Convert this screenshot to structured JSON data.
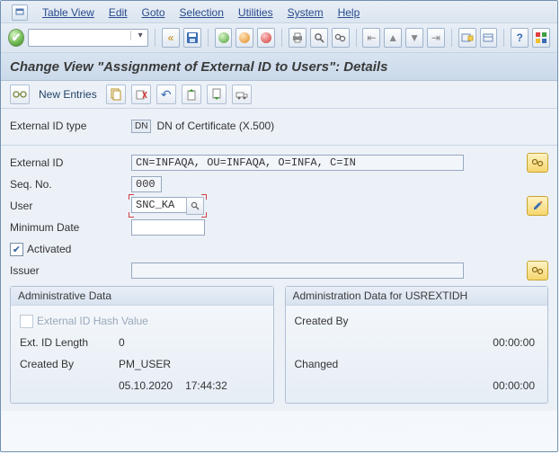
{
  "menu": {
    "items": [
      "Table View",
      "Edit",
      "Goto",
      "Selection",
      "Utilities",
      "System",
      "Help"
    ]
  },
  "title": "Change View \"Assignment of External ID to Users\": Details",
  "comp_toolbar": {
    "glasses_label": "Glasses",
    "new_entries": "New Entries"
  },
  "ext_type": {
    "label": "External ID type",
    "code": "DN",
    "desc": "DN of Certificate (X.500)"
  },
  "form": {
    "external_id": {
      "label": "External ID",
      "value": "CN=INFAQA, OU=INFAQA, O=INFA, C=IN"
    },
    "seq_no": {
      "label": "Seq. No.",
      "value": "000"
    },
    "user": {
      "label": "User",
      "value": "SNC_KA"
    },
    "min_date": {
      "label": "Minimum Date",
      "value": ""
    },
    "activated": {
      "label": "Activated",
      "checked": true
    },
    "issuer": {
      "label": "Issuer",
      "value": ""
    }
  },
  "admin": {
    "title": "Administrative Data",
    "hash_label": "External ID Hash Value",
    "ext_len_label": "Ext. ID Length",
    "ext_len": "0",
    "created_by_label": "Created By",
    "created_by": "PM_USER",
    "created_date": "05.10.2020",
    "created_time": "17:44:32"
  },
  "admin2": {
    "title": "Administration Data for USREXTIDH",
    "created_by_label": "Created By",
    "created_time": "00:00:00",
    "changed_label": "Changed",
    "changed_time": "00:00:00"
  }
}
